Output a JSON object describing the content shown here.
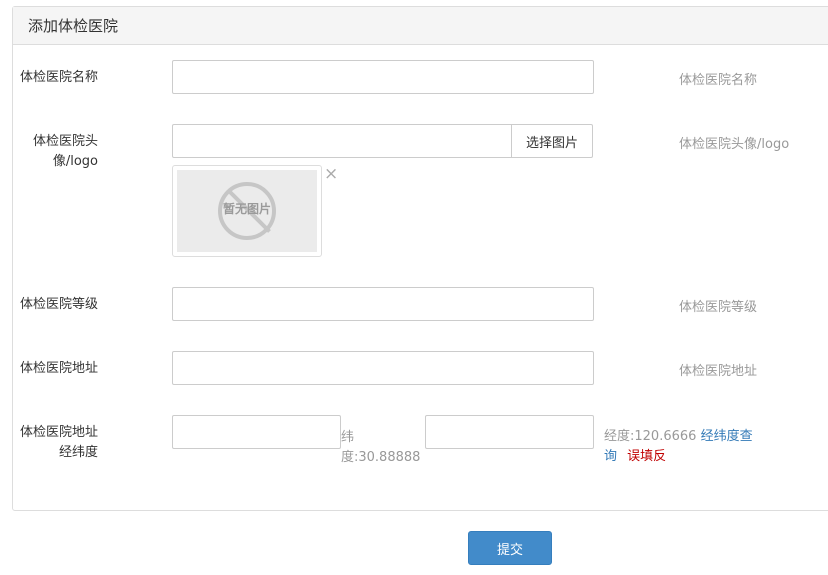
{
  "panel": {
    "title": "添加体检医院"
  },
  "fields": {
    "name": {
      "label": "体检医院名称",
      "value": "",
      "help": "体检医院名称"
    },
    "logo": {
      "label_line1": "体检医院头",
      "label_line2": "像/logo",
      "value": "",
      "choose_button": "选择图片",
      "placeholder_image_text": "暂无图片",
      "remove_icon": "×",
      "help": "体检医院头像/logo"
    },
    "level": {
      "label": "体检医院等级",
      "value": "",
      "help": "体检医院等级"
    },
    "address": {
      "label": "体检医院地址",
      "value": "",
      "help": "体检医院地址"
    },
    "coords": {
      "label_line1": "体检医院地址",
      "label_line2": "经纬度",
      "input1_value": "",
      "lat_line1": "纬",
      "lat_line2": "度:30.88888",
      "input2_value": "",
      "lng_text": "经度:120.6666",
      "lookup_link_line1": "经纬度查",
      "lookup_link_line2": "询",
      "error_text": "误填反"
    }
  },
  "submit": {
    "label": "提交"
  },
  "colors": {
    "primary": "#428bca",
    "link": "#337ab7",
    "error": "#c00000",
    "help": "#999999"
  }
}
